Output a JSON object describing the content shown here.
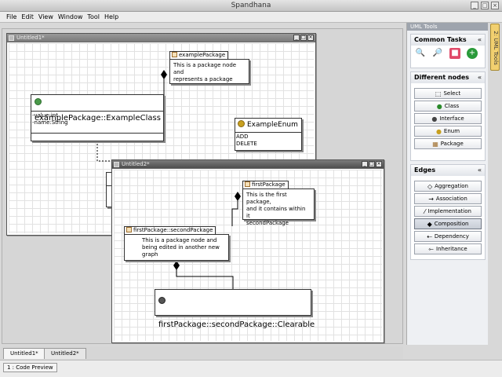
{
  "window": {
    "title": "Spandhana"
  },
  "menu": [
    "File",
    "Edit",
    "View",
    "Window",
    "Tool",
    "Help"
  ],
  "doc1": {
    "title": "Untitled1*",
    "pkg": {
      "tab": "examplePackage",
      "body": [
        "This is a package node and",
        "represents a package"
      ]
    },
    "cls": {
      "name": "examplePackage::ExampleClass",
      "attrs": [
        "-value:int",
        "-name:String"
      ]
    },
    "enum": {
      "name": "ExampleEnum",
      "values": [
        "ADD",
        "DELETE"
      ]
    }
  },
  "doc2": {
    "title": "Untitled2*",
    "pkg1": {
      "tab": "firstPackage",
      "body": [
        "This is the first package,",
        "and it contains within it",
        "secondPackage"
      ]
    },
    "pkg2": {
      "tab": "firstPackage::secondPackage",
      "body": [
        "This is a package node and",
        "being edited in another new",
        "graph"
      ]
    },
    "iface": {
      "name": "firstPackage::secondPackage::Clearable"
    }
  },
  "panel": {
    "header": "UML Tools",
    "vtab": "2: UML Tools",
    "common_title": "Common Tasks",
    "common_icons": [
      "zoom-in-icon",
      "zoom-out-icon",
      "delete-icon",
      "add-icon"
    ],
    "nodes_title": "Different nodes",
    "nodes": [
      "Select",
      "Class",
      "Interface",
      "Enum",
      "Package"
    ],
    "edges_title": "Edges",
    "edges": [
      "Aggregation",
      "Association",
      "Implementation",
      "Composition",
      "Dependency",
      "Inheritance"
    ],
    "selected_edge": "Composition"
  },
  "tabs": [
    "Untitled1*",
    "Untitled2*"
  ],
  "status": {
    "code_preview": "1 : Code Preview"
  },
  "colors": {
    "selected": "#c8cdd6",
    "vtab": "#f2d070"
  }
}
